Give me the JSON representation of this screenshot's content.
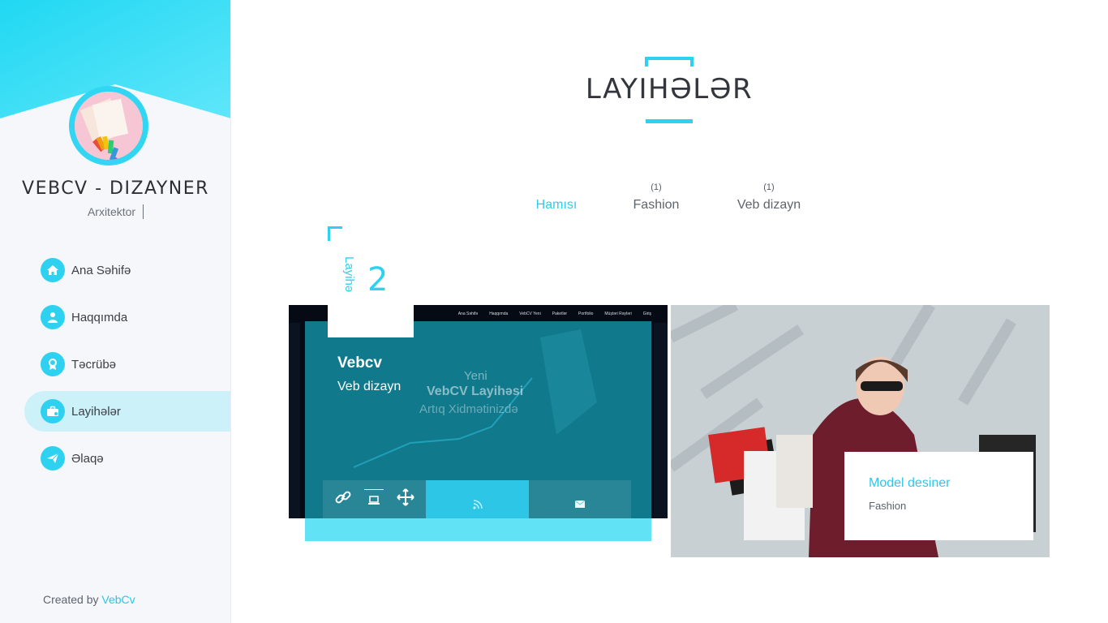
{
  "sidebar": {
    "site_name": "VEBCV - DIZAYNER",
    "role": "Arxitektor",
    "nav": [
      {
        "label": "Ana Səhifə",
        "icon": "home-icon",
        "active": false
      },
      {
        "label": "Haqqımda",
        "icon": "user-icon",
        "active": false
      },
      {
        "label": "Təcrübə",
        "icon": "award-icon",
        "active": false
      },
      {
        "label": "Layihələr",
        "icon": "briefcase-icon",
        "active": true
      },
      {
        "label": "Əlaqə",
        "icon": "paper-plane-icon",
        "active": false
      }
    ],
    "footer": {
      "prefix": "Created by",
      "brand": "VebCv"
    }
  },
  "main": {
    "title": "LAYIHƏLƏR",
    "filters": [
      {
        "label": "Hamısı",
        "count": "",
        "active": true
      },
      {
        "label": "Fashion",
        "count": "(1)",
        "active": false
      },
      {
        "label": "Veb dizayn",
        "count": "(1)",
        "active": false
      }
    ],
    "badge": {
      "word": "Layihə",
      "number": "2"
    },
    "projects": [
      {
        "title": "Vebcv",
        "category": "Veb dizayn",
        "preview": {
          "nav_items": [
            "Ana Səhifə",
            "Haqqımda",
            "VebCV Yeni",
            "Paketlər",
            "Portfolio",
            "Müştəri Rəyləri",
            "Giriş"
          ],
          "hero_line1": "Yeni",
          "hero_line2": "VebCV Layihəsi",
          "hero_line3": "Artıq Xidmətinizdə"
        },
        "actions": [
          "link-icon",
          "laptop-icon",
          "move-icon",
          "rss-icon",
          "envelope-icon"
        ]
      },
      {
        "title": "Model desiner",
        "category": "Fashion"
      }
    ]
  },
  "colors": {
    "accent": "#2ed2f0",
    "text_dark": "#33363c",
    "sidebar_bg": "#f5f7fb"
  }
}
